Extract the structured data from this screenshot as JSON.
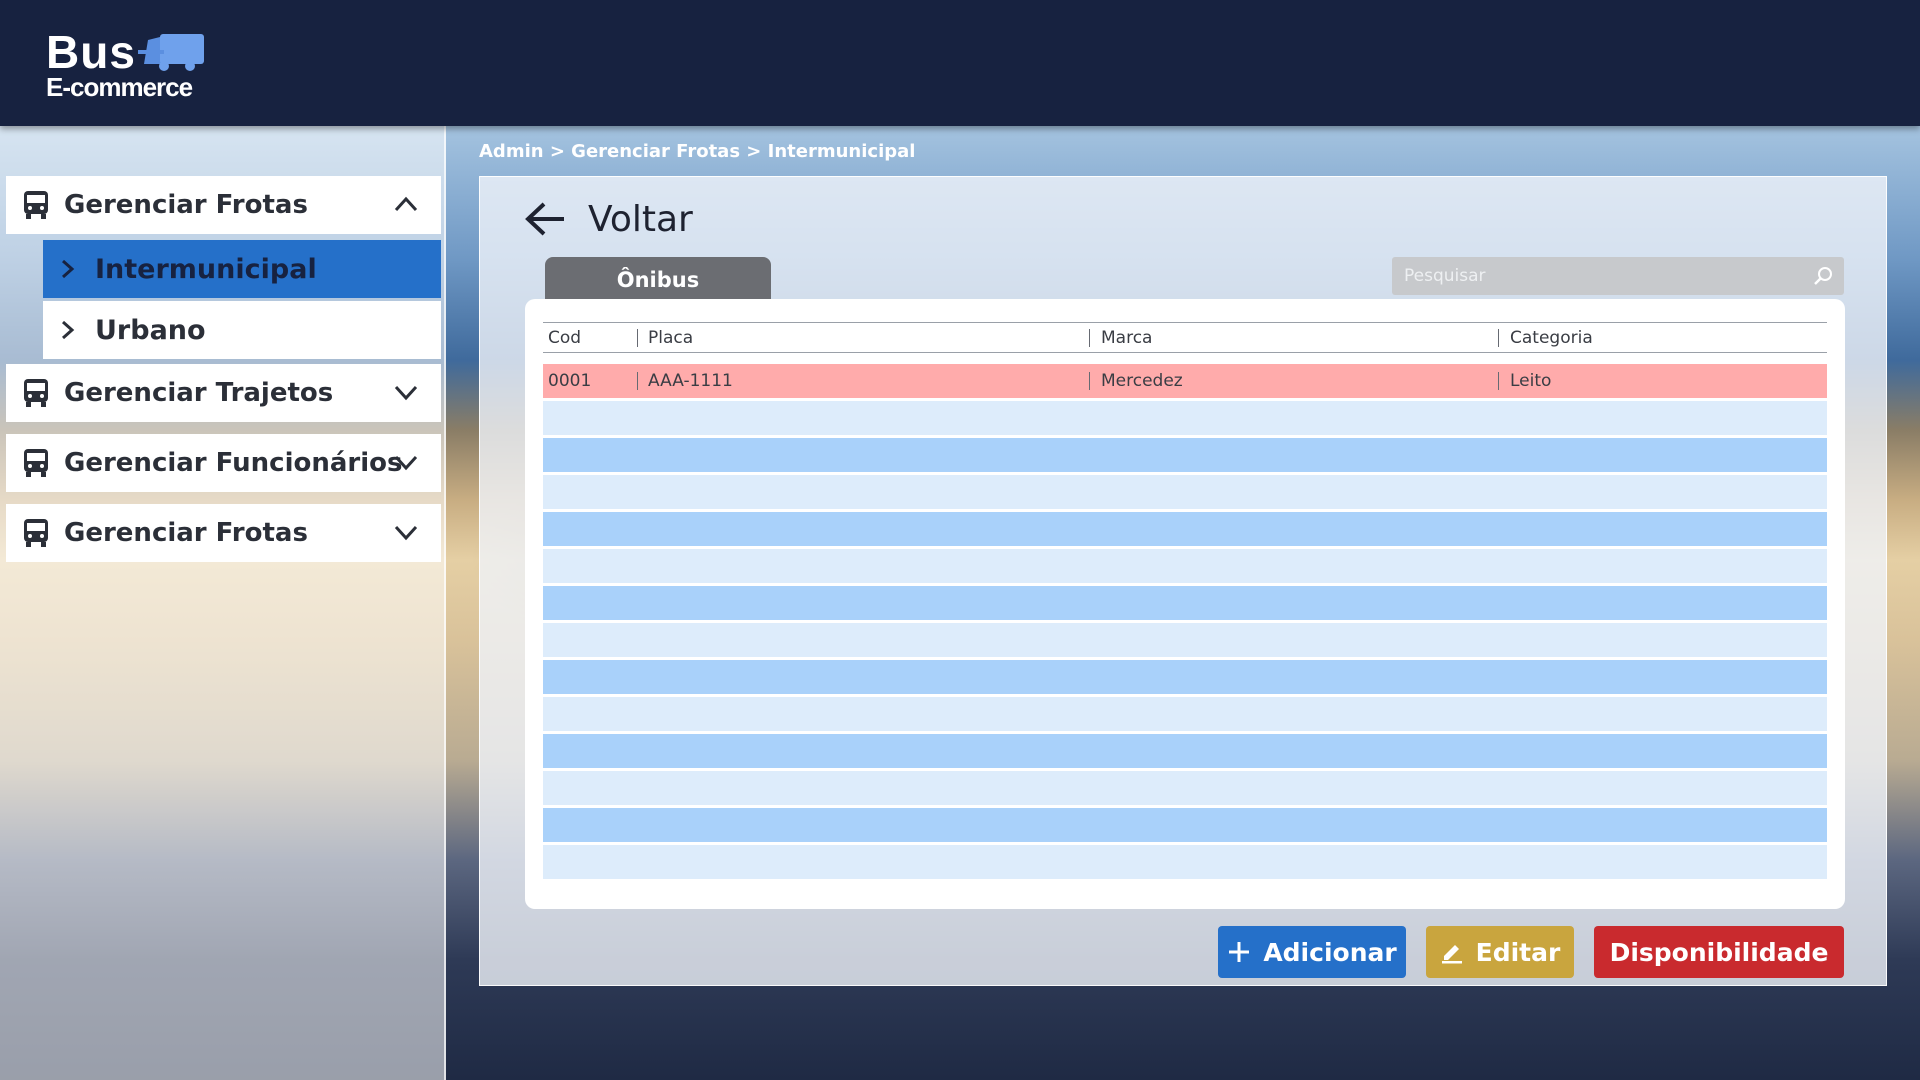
{
  "header": {
    "logo_top": "Bus",
    "logo_bottom": "E-commerce"
  },
  "sidebar": {
    "groups": [
      {
        "label": "Gerenciar Frotas",
        "icon": "bus-icon",
        "chevron": "chevron-up-icon",
        "expanded": true,
        "items": [
          {
            "label": "Intermunicipal",
            "active": true
          },
          {
            "label": "Urbano",
            "active": false
          }
        ]
      },
      {
        "label": "Gerenciar Trajetos",
        "icon": "bus-icon",
        "chevron": "chevron-down-icon",
        "expanded": false
      },
      {
        "label": "Gerenciar Funcionários",
        "icon": "bus-icon",
        "chevron": "chevron-down-icon",
        "expanded": false
      },
      {
        "label": "Gerenciar Frotas",
        "icon": "bus-icon",
        "chevron": "chevron-down-icon",
        "expanded": false
      }
    ]
  },
  "breadcrumb": "Admin > Gerenciar Frotas > Intermunicipal",
  "main": {
    "back_label": "Voltar",
    "tab_label": "Ônibus",
    "search": {
      "placeholder": "Pesquisar",
      "value": ""
    },
    "table": {
      "columns": [
        "Cod",
        "Placa",
        "Marca",
        "Categoria"
      ],
      "rows": [
        {
          "cod": "0001",
          "placa": "AAA-1111",
          "marca": "Mercedez",
          "categoria": "Leito",
          "selected": true
        }
      ],
      "empty_rows": 13
    },
    "buttons": {
      "add": "Adicionar",
      "edit": "Editar",
      "availability": "Disponibilidade"
    }
  },
  "colors": {
    "header_bg": "#172240",
    "active_item": "#2570c9",
    "selected_row": "#ffabab",
    "row_light": "#ddecfb",
    "row_dark": "#a9d1fa",
    "btn_add": "#2570c9",
    "btn_edit": "#c9a53e",
    "btn_availability": "#c92a2e"
  }
}
